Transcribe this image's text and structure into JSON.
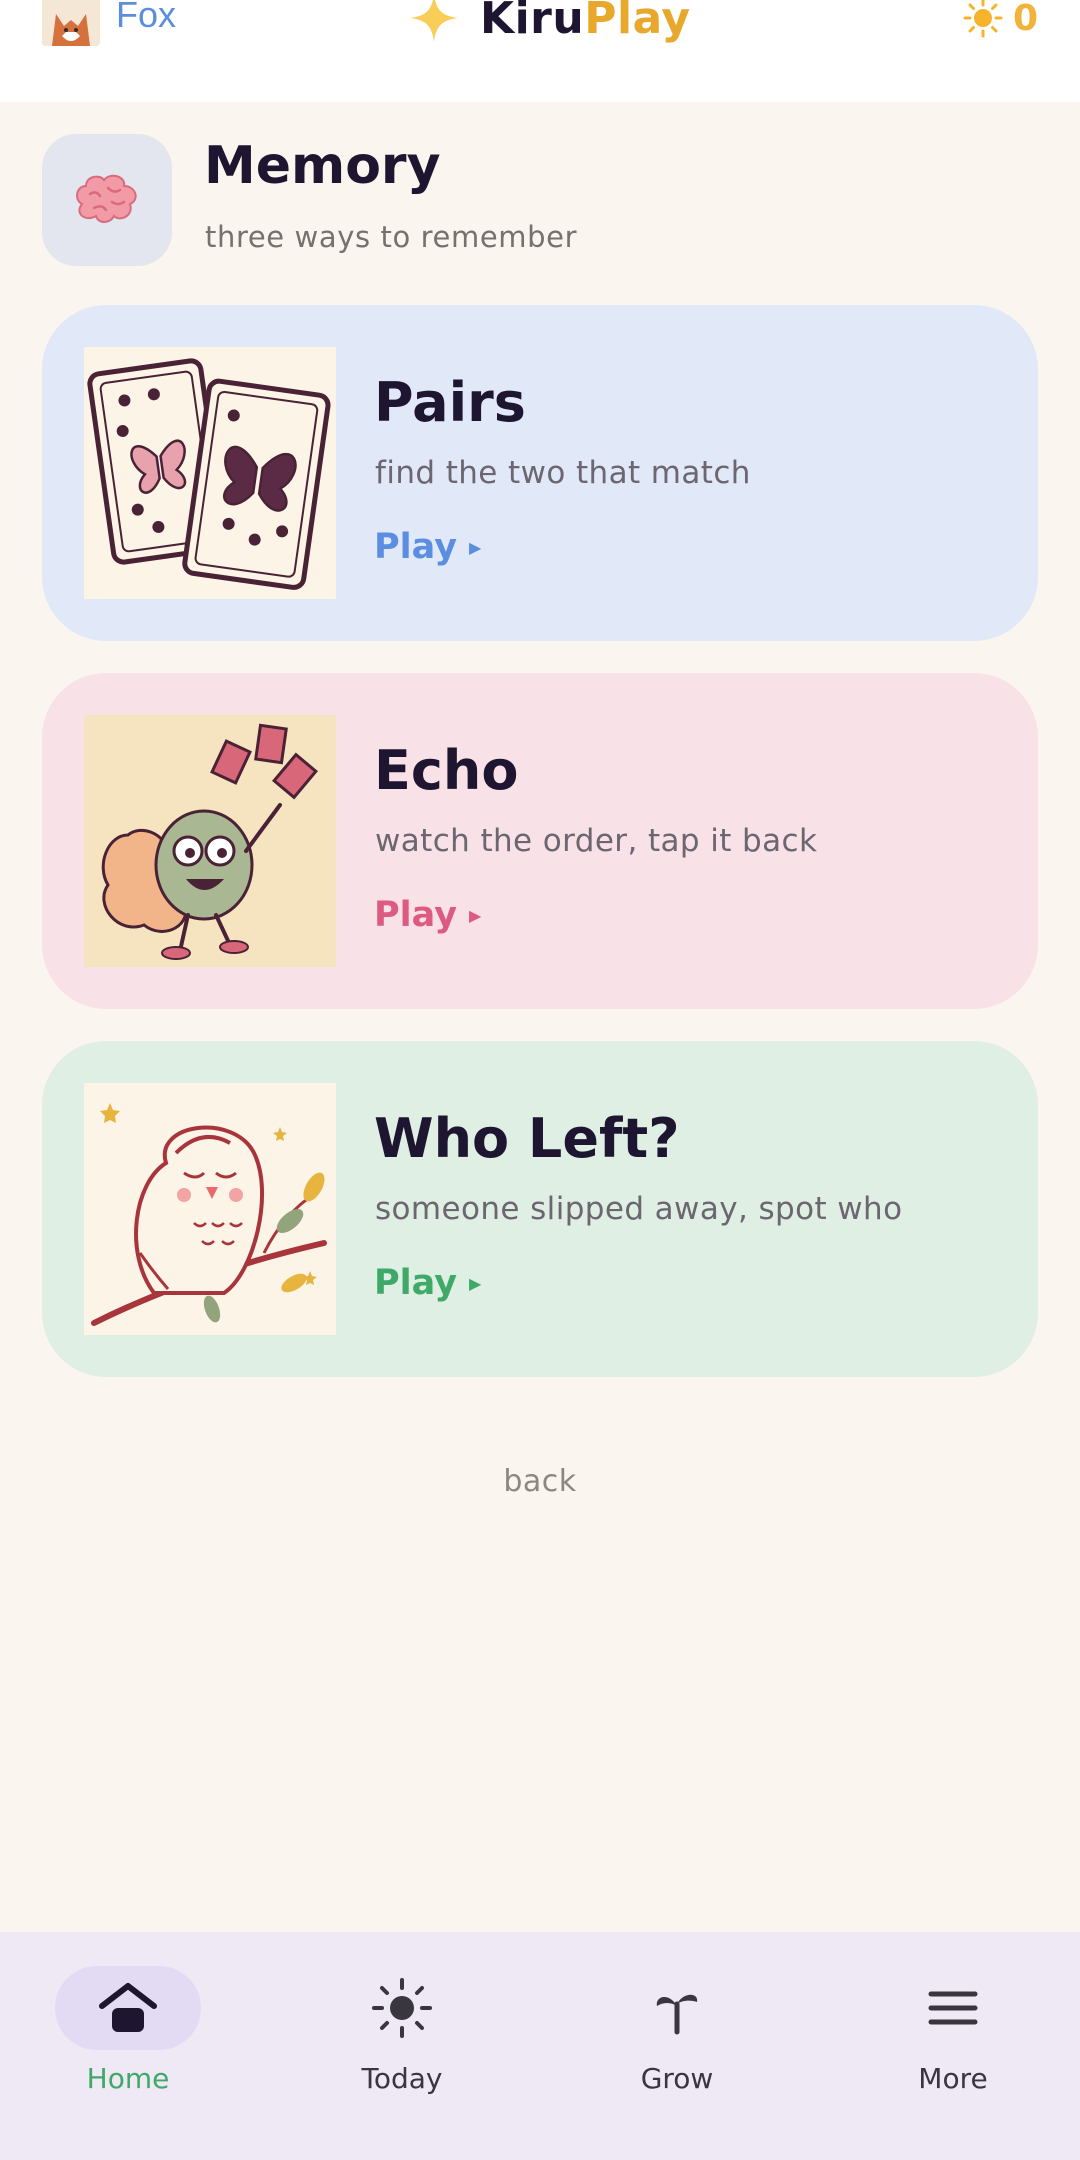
{
  "header": {
    "username": "Fox",
    "brand_part1": "Kiru",
    "brand_part2": "Play",
    "sun_count": "0",
    "icons": {
      "avatar": "fox-avatar",
      "brand": "sparkle-star-icon",
      "sun": "sun-icon"
    }
  },
  "section": {
    "title": "Memory",
    "subtitle": "three ways to remember",
    "icon": "brain-icon"
  },
  "games": [
    {
      "title": "Pairs",
      "subtitle": "find the two that match",
      "play_label": "Play",
      "accent": "#5B8DE0",
      "bg": "#E1E9F9"
    },
    {
      "title": "Echo",
      "subtitle": "watch the order, tap it back",
      "play_label": "Play",
      "accent": "#DD5A82",
      "bg": "#F9E2E7"
    },
    {
      "title": "Who Left?",
      "subtitle": "someone slipped away, spot who",
      "play_label": "Play",
      "accent": "#3FA968",
      "bg": "#DFEFE4"
    }
  ],
  "back_label": "back",
  "nav": {
    "items": [
      {
        "label": "Home",
        "icon": "home-icon",
        "active": true
      },
      {
        "label": "Today",
        "icon": "sun-icon",
        "active": false
      },
      {
        "label": "Grow",
        "icon": "sprout-icon",
        "active": false
      },
      {
        "label": "More",
        "icon": "menu-icon",
        "active": false
      }
    ]
  },
  "colors": {
    "background": "#FAF6EF",
    "text": "#1E1530",
    "brand_accent": "#E8A82B",
    "active_nav": "#3FA968"
  }
}
